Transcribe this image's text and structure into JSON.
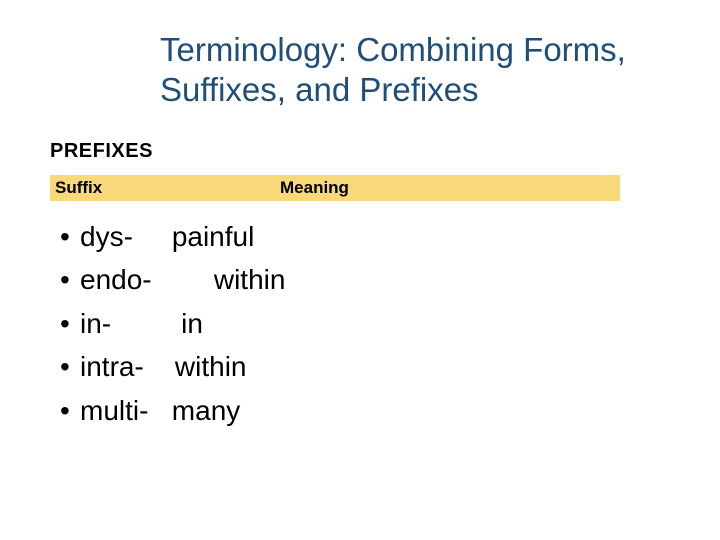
{
  "title": "Terminology: Combining Forms, Suffixes, and Prefixes",
  "section": "PREFIXES",
  "columns": {
    "left": "Suffix",
    "right": "Meaning"
  },
  "rows": [
    {
      "bullet": "•",
      "term": "dys-",
      "gap": "     ",
      "meaning": "painful"
    },
    {
      "bullet": "•",
      "term": "endo-",
      "gap": "        ",
      "meaning": "within"
    },
    {
      "bullet": "•",
      "term": "in-",
      "gap": "         ",
      "meaning": "in"
    },
    {
      "bullet": "•",
      "term": "intra-",
      "gap": "    ",
      "meaning": "within"
    },
    {
      "bullet": "•",
      "term": "multi-",
      "gap": "   ",
      "meaning": "many"
    }
  ]
}
